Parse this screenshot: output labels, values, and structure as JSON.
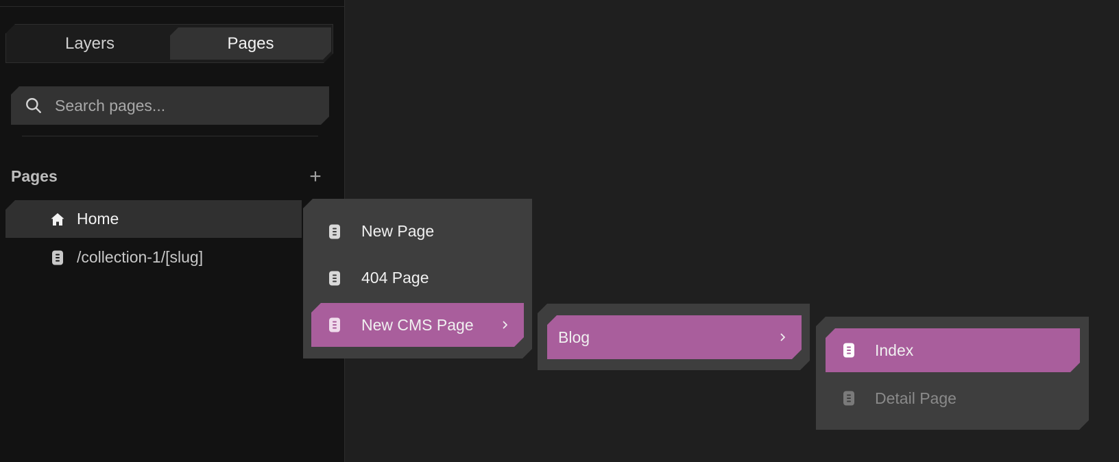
{
  "tabs": {
    "layers": "Layers",
    "pages": "Pages"
  },
  "search": {
    "placeholder": "Search pages..."
  },
  "pages_section": {
    "title": "Pages",
    "add": "+",
    "items": [
      {
        "label": "Home",
        "icon": "home-icon"
      },
      {
        "label": "/collection-1/[slug]",
        "icon": "page-icon"
      }
    ]
  },
  "add_page_menu": {
    "items": [
      {
        "label": "New Page",
        "icon": "page-icon"
      },
      {
        "label": "404 Page",
        "icon": "page-icon"
      },
      {
        "label": "New CMS Page",
        "icon": "page-icon",
        "has_submenu": true,
        "highlighted": true
      }
    ]
  },
  "cms_menu": {
    "items": [
      {
        "label": "Blog",
        "has_submenu": true,
        "highlighted": true
      }
    ]
  },
  "blog_menu": {
    "items": [
      {
        "label": "Index",
        "icon": "page-icon",
        "highlighted": true
      },
      {
        "label": "Detail Page",
        "icon": "page-icon",
        "disabled": true
      }
    ]
  },
  "colors": {
    "accent": "#a95e9c",
    "menu_bg": "#3e3e3e",
    "sidebar_bg": "#121212",
    "canvas_bg": "#1f1f1f"
  }
}
